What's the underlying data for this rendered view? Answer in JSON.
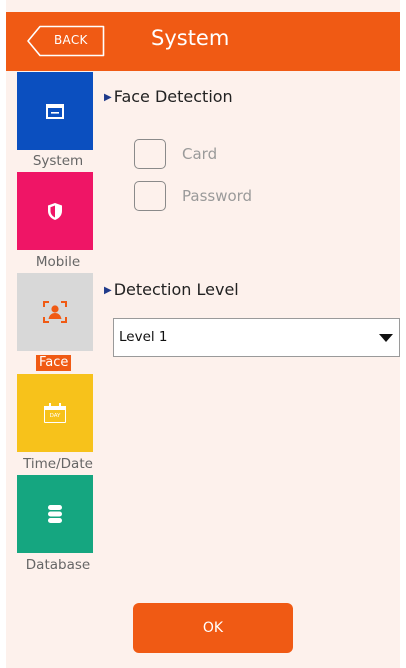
{
  "header": {
    "back_label": "BACK",
    "title": "System"
  },
  "sidebar": {
    "items": [
      {
        "label": "System",
        "icon": "window-icon",
        "color": "#0b4fbf"
      },
      {
        "label": "Mobile",
        "icon": "shield-icon",
        "color": "#ef1566"
      },
      {
        "label": "Face",
        "icon": "face-scan-icon",
        "color": "#d8d8d8",
        "active": true
      },
      {
        "label": "Time/Date",
        "icon": "calendar-icon",
        "color": "#f7c21b",
        "icon_text": "DAY"
      },
      {
        "label": "Database",
        "icon": "database-icon",
        "color": "#15a680"
      }
    ]
  },
  "face_detection": {
    "title": "Face Detection",
    "options": [
      {
        "label": "Card",
        "checked": false
      },
      {
        "label": "Password",
        "checked": false
      }
    ]
  },
  "detection_level": {
    "title": "Detection Level",
    "selected": "Level 1"
  },
  "footer": {
    "ok_label": "OK"
  },
  "colors": {
    "accent": "#f05a14",
    "background": "#fdf1ec"
  }
}
